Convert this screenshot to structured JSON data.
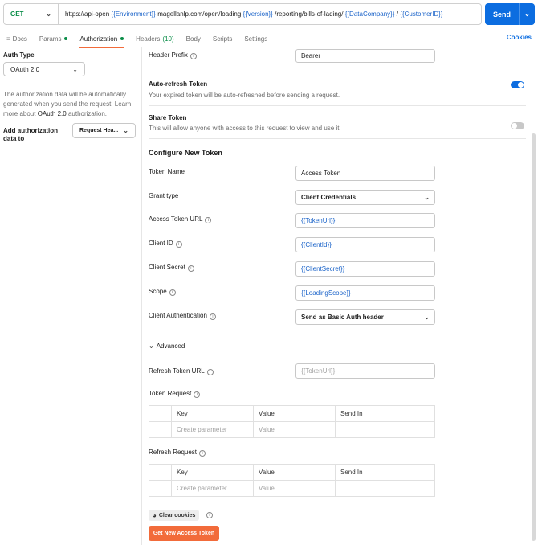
{
  "request": {
    "method": "GET",
    "url_segments": [
      {
        "text": "https://api-open ",
        "var": false
      },
      {
        "text": "{{Environment}}",
        "var": true
      },
      {
        "text": " magellanlp.com/open/loading ",
        "var": false
      },
      {
        "text": "{{Version}}",
        "var": true
      },
      {
        "text": " /reporting/bills-of-lading/ ",
        "var": false
      },
      {
        "text": "{{DataCompany}}",
        "var": true
      },
      {
        "text": " / ",
        "var": false
      },
      {
        "text": "{{CustomerID}}",
        "var": true
      }
    ],
    "send_label": "Send"
  },
  "tabs": [
    {
      "label": "Docs",
      "icon": "doc-lines-icon"
    },
    {
      "label": "Params",
      "dot": true
    },
    {
      "label": "Authorization",
      "dot": true,
      "active": true
    },
    {
      "label": "Headers",
      "count": "(10)"
    },
    {
      "label": "Body"
    },
    {
      "label": "Scripts"
    },
    {
      "label": "Settings"
    }
  ],
  "cookies_label": "Cookies",
  "left": {
    "auth_type_label": "Auth Type",
    "auth_type_value": "OAuth 2.0",
    "description_pre": "The authorization data will be automatically generated when you send the request. Learn more about ",
    "description_link": "OAuth 2.0",
    "description_post": " authorization.",
    "add_auth_label": "Add authorization data to",
    "add_auth_value": "Request Hea..."
  },
  "form": {
    "header_prefix": {
      "label": "Header Prefix",
      "value": "Bearer"
    },
    "auto_refresh": {
      "label": "Auto-refresh Token",
      "desc": "Your expired token will be auto-refreshed before sending a request.",
      "on": true
    },
    "share_token": {
      "label": "Share Token",
      "desc": "This will allow anyone with access to this request to view and use it.",
      "on": false
    },
    "section_title": "Configure New Token",
    "token_name": {
      "label": "Token Name",
      "value": "Access Token"
    },
    "grant_type": {
      "label": "Grant type",
      "value": "Client Credentials"
    },
    "access_token_url": {
      "label": "Access Token URL",
      "value": "{{TokenUrl}}"
    },
    "client_id": {
      "label": "Client ID",
      "value": "{{ClientId}}"
    },
    "client_secret": {
      "label": "Client Secret",
      "value": "{{ClientSecret}}"
    },
    "scope": {
      "label": "Scope",
      "value": "{{LoadingScope}}"
    },
    "client_auth": {
      "label": "Client Authentication",
      "value": "Send as Basic Auth header"
    },
    "advanced_label": "Advanced",
    "refresh_token_url": {
      "label": "Refresh Token URL",
      "placeholder": "{{TokenUrl}}"
    },
    "token_request": {
      "label": "Token Request"
    },
    "refresh_request": {
      "label": "Refresh Request"
    },
    "table": {
      "headers": [
        "Key",
        "Value",
        "Send In"
      ],
      "key_placeholder": "Create parameter",
      "value_placeholder": "Value"
    },
    "clear_cookies_label": "Clear cookies",
    "get_token_label": "Get New Access Token"
  }
}
